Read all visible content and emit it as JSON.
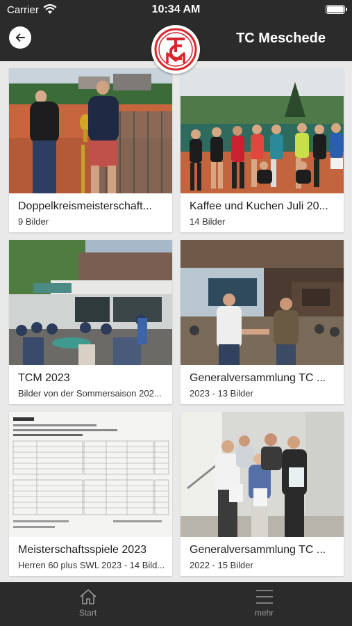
{
  "status_bar": {
    "carrier": "Carrier",
    "time": "10:34 AM"
  },
  "header": {
    "title": "TC Meschede",
    "logo_text": "TCM",
    "logo_year": "1926 e.V."
  },
  "albums": [
    {
      "title": "Doppelkreismeisterschaft...",
      "subtitle": "9 Bilder"
    },
    {
      "title": "Kaffee und Kuchen Juli 20...",
      "subtitle": "14 Bilder"
    },
    {
      "title": "TCM 2023",
      "subtitle": "Bilder von der Sommersaison 202..."
    },
    {
      "title": "Generalversammlung TC ...",
      "subtitle": "2023 - 13 Bilder"
    },
    {
      "title": "Meisterschaftsspiele 2023",
      "subtitle": "Herren 60 plus SWL 2023 - 14 Bild..."
    },
    {
      "title": "Generalversammlung TC ...",
      "subtitle": "2022 - 15 Bilder"
    }
  ],
  "tab_bar": {
    "start_label": "Start",
    "more_label": "mehr"
  },
  "colors": {
    "bar": "#2b2b2b",
    "background": "#e9e9e9",
    "logo_red": "#d7262c"
  },
  "icons": [
    "wifi-icon",
    "battery-icon",
    "back-arrow-icon",
    "home-icon",
    "menu-icon"
  ]
}
